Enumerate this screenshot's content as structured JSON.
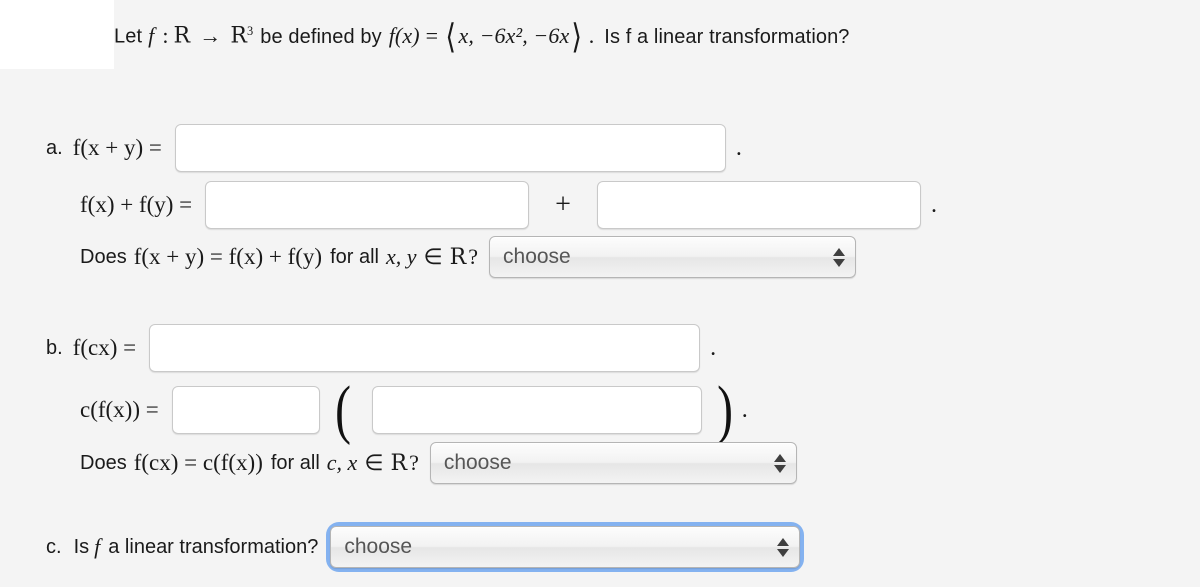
{
  "background_color": "#f4f4f4",
  "focus_ring_color": "#84b2f0",
  "problem": {
    "prefix": "Let",
    "function_name": "f",
    "colon": ":",
    "domain": "R",
    "arrow": "→",
    "codomain": "R",
    "codomain_exponent": "3",
    "defined_by": "be defined by",
    "fx_label": "f(x)",
    "equals": "=",
    "vector_open": "⟨",
    "vector_components": "x, −6x², −6x",
    "vector_close": "⟩",
    "period": ".",
    "question": "Is f a linear transformation?"
  },
  "parts": {
    "a": {
      "letter": "a.",
      "line1": {
        "lhs": "f(x + y) =",
        "input_value": "",
        "input_placeholder": "",
        "trailing_punctuation": "."
      },
      "line2": {
        "lhs": "f(x) + f(y) =",
        "input1_value": "",
        "input1_placeholder": "",
        "operator": "+",
        "input2_value": "",
        "input2_placeholder": "",
        "trailing_punctuation": "."
      },
      "line3": {
        "question_prefix": "Does",
        "question_math": "f(x + y) = f(x) + f(y)",
        "question_suffix": "for all",
        "quantifier": "x, y",
        "member_symbol": "∈",
        "set_symbol": "R",
        "question_mark": "?",
        "select_value": "choose",
        "select_options": [
          "choose"
        ],
        "focused": false
      }
    },
    "b": {
      "letter": "b.",
      "line1": {
        "lhs": "f(cx) =",
        "input_value": "",
        "input_placeholder": "",
        "trailing_punctuation": "."
      },
      "line2": {
        "lhs": "c(f(x)) =",
        "input1_value": "",
        "input1_placeholder": "",
        "paren_open": "(",
        "input2_value": "",
        "input2_placeholder": "",
        "paren_close": ")",
        "trailing_punctuation": "."
      },
      "line3": {
        "question_prefix": "Does",
        "question_math": "f(cx) = c(f(x))",
        "question_suffix": "for all",
        "quantifier": "c, x",
        "member_symbol": "∈",
        "set_symbol": "R",
        "question_mark": "?",
        "select_value": "choose",
        "select_options": [
          "choose"
        ],
        "focused": false
      }
    },
    "c": {
      "letter": "c.",
      "question_prefix": "Is",
      "question_var": "f",
      "question_suffix": "a linear transformation?",
      "select_value": "choose",
      "select_options": [
        "choose"
      ],
      "focused": true
    }
  },
  "icons": {
    "stepper_up": "triangle-up-icon",
    "stepper_down": "triangle-down-icon"
  }
}
